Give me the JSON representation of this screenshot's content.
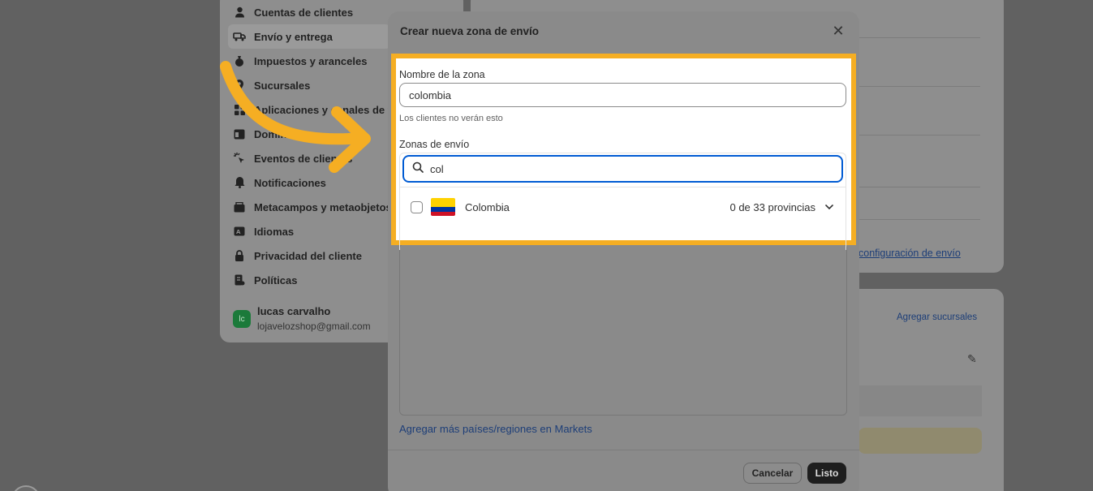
{
  "sidebar": {
    "items": [
      {
        "label": "Cuentas de clientes",
        "icon": "person-icon"
      },
      {
        "label": "Envío y entrega",
        "icon": "truck-icon",
        "active": true
      },
      {
        "label": "Impuestos y aranceles",
        "icon": "tax-bag-icon"
      },
      {
        "label": "Sucursales",
        "icon": "location-pin-icon"
      },
      {
        "label": "Aplicaciones y canales de ventas",
        "icon": "apps-icon"
      },
      {
        "label": "Dominios",
        "icon": "globe-icon"
      },
      {
        "label": "Eventos de clientes",
        "icon": "cursor-click-icon"
      },
      {
        "label": "Notificaciones",
        "icon": "bell-icon"
      },
      {
        "label": "Metacampos y metaobjetos",
        "icon": "database-icon"
      },
      {
        "label": "Idiomas",
        "icon": "language-icon"
      },
      {
        "label": "Privacidad del cliente",
        "icon": "lock-icon"
      },
      {
        "label": "Políticas",
        "icon": "policy-icon"
      }
    ],
    "user": {
      "initials": "lc",
      "name": "lucas carvalho",
      "email": "lojavelozshop@gmail.com"
    }
  },
  "background": {
    "ship_link": "configuración de envío",
    "branch_link": "Agregar sucursales"
  },
  "modal": {
    "title": "Crear nueva zona de envío",
    "zone_name_label": "Nombre de la zona",
    "zone_name_value": "colombia",
    "zone_name_hint": "Los clientes no verán esto",
    "zones_label": "Zonas de envío",
    "search_value": "col",
    "results": [
      {
        "country": "Colombia",
        "provinces": "0 de 33 provincias",
        "flag_colors": [
          "#ffd200",
          "#0033a0",
          "#ce1126"
        ]
      }
    ],
    "markets_link": "Agregar más países/regiones en Markets",
    "cancel_label": "Cancelar",
    "done_label": "Listo"
  },
  "colors": {
    "highlight": "#f5ae23",
    "focus": "#005bd3",
    "link": "#1d3e78"
  }
}
